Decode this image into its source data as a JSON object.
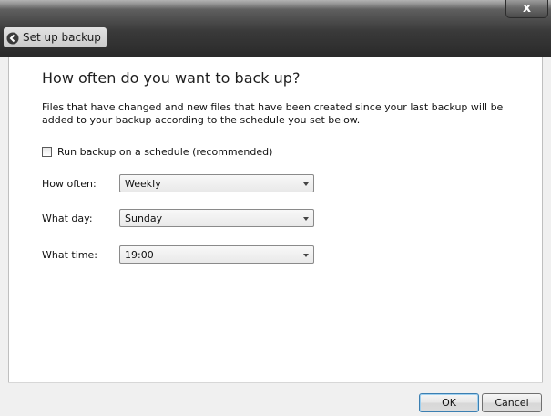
{
  "window": {
    "title": "Set up backup",
    "close_glyph": "x"
  },
  "page": {
    "heading": "How often do you want to back up?",
    "description": "Files that have changed and new files that have been created since your last backup will be added to your backup according to the schedule you set below.",
    "schedule_checkbox": {
      "label": "Run backup on a schedule (recommended)",
      "checked": false
    },
    "fields": {
      "how_often": {
        "label": "How often:",
        "value": "Weekly"
      },
      "what_day": {
        "label": "What day:",
        "value": "Sunday"
      },
      "what_time": {
        "label": "What time:",
        "value": "19:00"
      }
    }
  },
  "footer": {
    "ok_label": "OK",
    "cancel_label": "Cancel"
  },
  "icons": {
    "back": "back-arrow-icon",
    "close": "close-icon",
    "dropdown": "chevron-down-icon"
  }
}
